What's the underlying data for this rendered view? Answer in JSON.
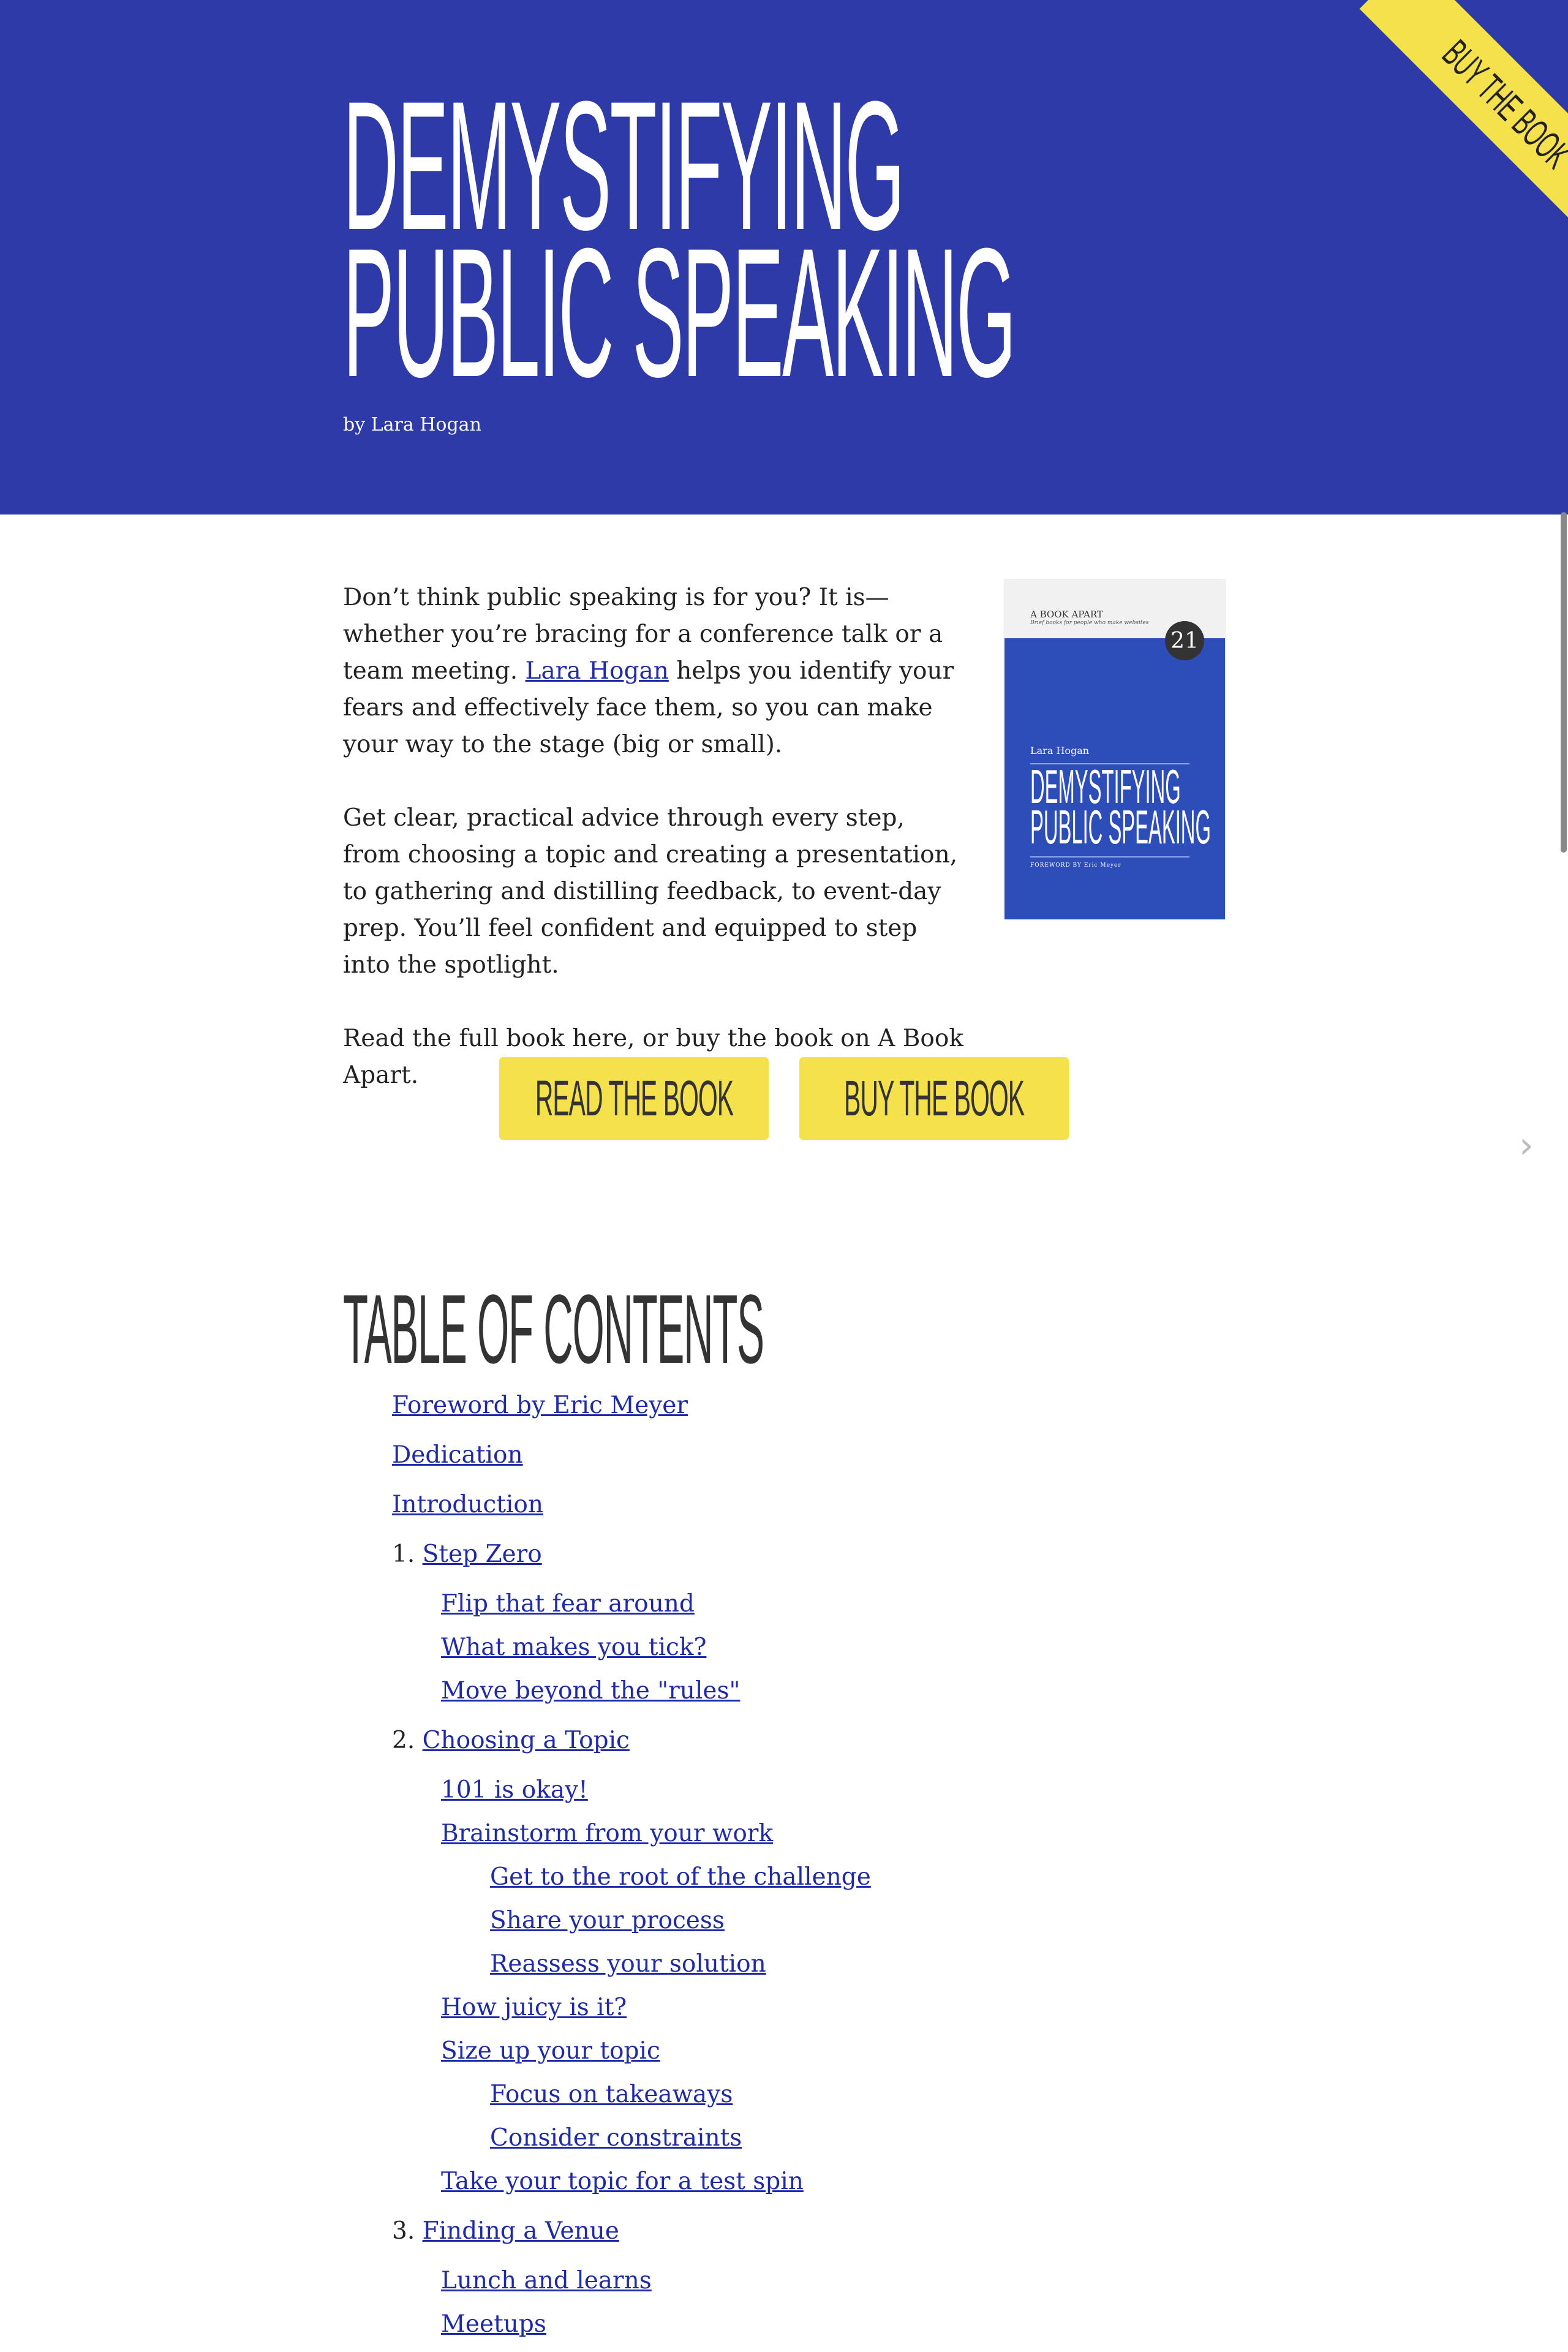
{
  "hero": {
    "title_lines": [
      "DEMYSTIFYING",
      "PUBLIC SPEAKING"
    ],
    "author": "by Lara Hogan",
    "ribbon_label": "BUY THE BOOK",
    "background_color": "#2e3aa8"
  },
  "intro": {
    "p1_before": "Don’t think public speaking is for you? It is—whether you’re bracing for a conference talk or a team meeting. ",
    "p1_link": "Lara Hogan",
    "p1_after": " helps you identify your fears and effectively face them, so you can make your way to the stage (big or small).",
    "p2": "Get clear, practical advice through every step, from choosing a topic and creating a presentation, to gathering and distilling feedback, to event-day prep. You’ll feel confident and equipped to step into the spotlight.",
    "p3": "Read the full book here, or buy the book on A Book Apart."
  },
  "cover": {
    "publisher": "A BOOK APART",
    "tagline": "Brief books for people who make websites",
    "number": "21",
    "author": "Lara Hogan",
    "title_lines": [
      "DEMYSTIFYING",
      "PUBLIC SPEAKING"
    ],
    "foreword": "FOREWORD BY Eric Meyer"
  },
  "buttons": {
    "read": "READ THE BOOK",
    "buy": "BUY THE BOOK",
    "accent_color": "#f5e14b"
  },
  "toc": {
    "heading": "TABLE OF CONTENTS",
    "items": [
      {
        "num": "",
        "label": "Foreword by Eric Meyer",
        "level": 0
      },
      {
        "num": "",
        "label": "Dedication",
        "level": 0
      },
      {
        "num": "",
        "label": "Introduction",
        "level": 0
      },
      {
        "num": "1.",
        "label": "Step Zero",
        "level": 0
      },
      {
        "num": "",
        "label": "Flip that fear around",
        "level": 1
      },
      {
        "num": "",
        "label": "What makes you tick?",
        "level": 1
      },
      {
        "num": "",
        "label": "Move beyond the \"rules\"",
        "level": 1
      },
      {
        "num": "2.",
        "label": "Choosing a Topic",
        "level": 0
      },
      {
        "num": "",
        "label": "101 is okay!",
        "level": 1
      },
      {
        "num": "",
        "label": "Brainstorm from your work",
        "level": 1
      },
      {
        "num": "",
        "label": "Get to the root of the challenge",
        "level": 2
      },
      {
        "num": "",
        "label": "Share your process",
        "level": 2
      },
      {
        "num": "",
        "label": "Reassess your solution",
        "level": 2
      },
      {
        "num": "",
        "label": "How juicy is it?",
        "level": 1
      },
      {
        "num": "",
        "label": "Size up your topic",
        "level": 1
      },
      {
        "num": "",
        "label": "Focus on takeaways",
        "level": 2
      },
      {
        "num": "",
        "label": "Consider constraints",
        "level": 2
      },
      {
        "num": "",
        "label": "Take your topic for a test spin",
        "level": 1
      },
      {
        "num": "3.",
        "label": "Finding a Venue",
        "level": 0
      },
      {
        "num": "",
        "label": "Lunch and learns",
        "level": 1
      },
      {
        "num": "",
        "label": "Meetups",
        "level": 1
      }
    ]
  }
}
